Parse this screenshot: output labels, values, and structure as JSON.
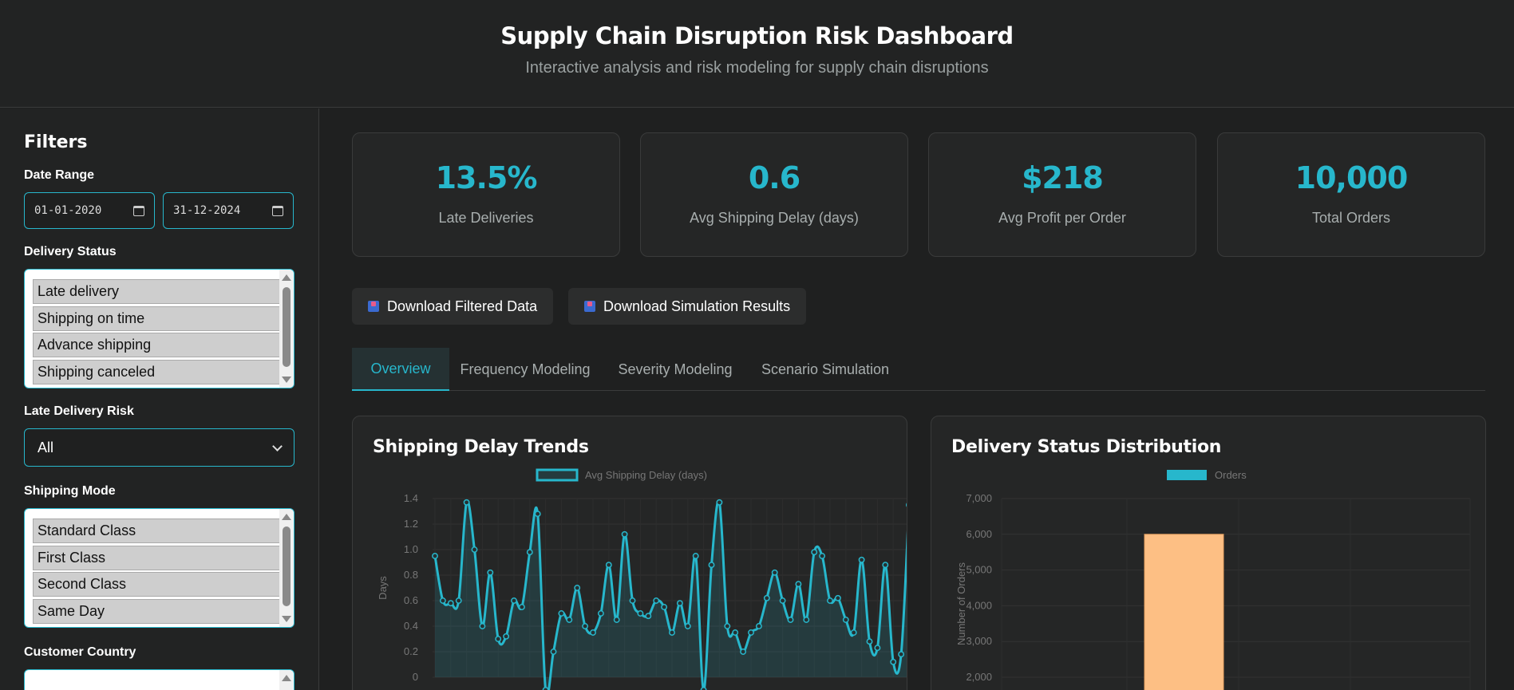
{
  "header": {
    "title": "Supply Chain Disruption Risk Dashboard",
    "subtitle": "Interactive analysis and risk modeling for supply chain disruptions"
  },
  "sidebar": {
    "title": "Filters",
    "date_range": {
      "label": "Date Range",
      "start": "01-01-2020",
      "end": "31-12-2024"
    },
    "delivery_status": {
      "label": "Delivery Status",
      "options": [
        "Late delivery",
        "Shipping on time",
        "Advance shipping",
        "Shipping canceled"
      ]
    },
    "late_delivery_risk": {
      "label": "Late Delivery Risk",
      "value": "All"
    },
    "shipping_mode": {
      "label": "Shipping Mode",
      "options": [
        "Standard Class",
        "First Class",
        "Second Class",
        "Same Day"
      ]
    },
    "customer_country": {
      "label": "Customer Country"
    }
  },
  "kpis": [
    {
      "value": "13.5%",
      "label": "Late Deliveries"
    },
    {
      "value": "0.6",
      "label": "Avg Shipping Delay (days)"
    },
    {
      "value": "$218",
      "label": "Avg Profit per Order"
    },
    {
      "value": "10,000",
      "label": "Total Orders"
    }
  ],
  "buttons": {
    "download_filtered": "Download Filtered Data",
    "download_simulation": "Download Simulation Results"
  },
  "tabs": [
    "Overview",
    "Frequency Modeling",
    "Severity Modeling",
    "Scenario Simulation"
  ],
  "active_tab": "Overview",
  "colors": {
    "accent": "#27b7cc",
    "bar": "#fdbf84",
    "background": "#1f2020"
  },
  "chart_data": [
    {
      "type": "line",
      "title": "Shipping Delay Trends",
      "ylabel": "Days",
      "series": [
        {
          "name": "Avg Shipping Delay (days)",
          "values": [
            0.95,
            0.6,
            0.58,
            0.6,
            1.37,
            1.0,
            0.4,
            0.82,
            0.3,
            0.32,
            0.6,
            0.55,
            0.98,
            1.28,
            -0.1,
            0.2,
            0.5,
            0.45,
            0.7,
            0.4,
            0.35,
            0.5,
            0.88,
            0.45,
            1.12,
            0.6,
            0.5,
            0.48,
            0.6,
            0.55,
            0.35,
            0.58,
            0.4,
            0.95,
            -0.1,
            0.88,
            1.37,
            0.4,
            0.35,
            0.2,
            0.35,
            0.4,
            0.62,
            0.82,
            0.6,
            0.45,
            0.73,
            0.45,
            0.98,
            0.95,
            0.6,
            0.62,
            0.45,
            0.35,
            0.92,
            0.28,
            0.23,
            0.88,
            0.12,
            0.18,
            1.35
          ]
        }
      ],
      "ylim": [
        0,
        1.4
      ],
      "yticks": [
        "1.4",
        "1.2",
        "1.0",
        "0.8",
        "0.6",
        "0.4",
        "0.2",
        "0"
      ],
      "legend": "top",
      "grid": true
    },
    {
      "type": "bar",
      "title": "Delivery Status Distribution",
      "ylabel": "Number of Orders",
      "series": [
        {
          "name": "Orders",
          "values": [
            6000
          ]
        }
      ],
      "ylim": [
        0,
        7000
      ],
      "yticks": [
        "7,000",
        "6,000",
        "5,000",
        "4,000",
        "3,000",
        "2,000"
      ],
      "legend": "top",
      "grid": true
    }
  ]
}
